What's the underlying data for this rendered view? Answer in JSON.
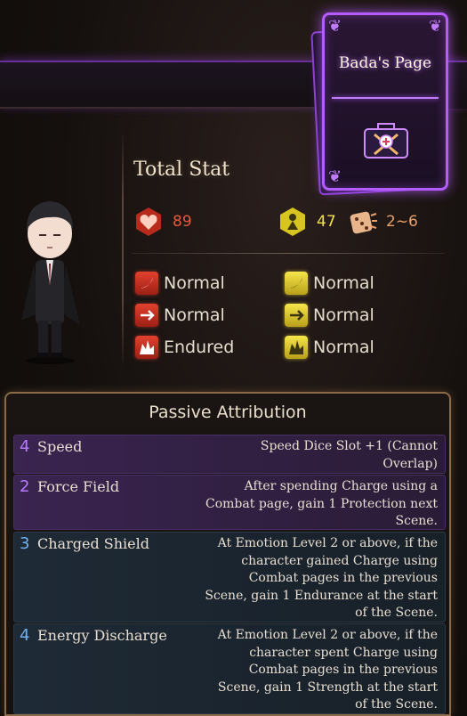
{
  "page_card": {
    "title": "Bada's Page",
    "emblem": "first-aid-kit-icon"
  },
  "total_stat": {
    "label": "Total Stat",
    "hp": "89",
    "stagger": "47",
    "speed": "2~6"
  },
  "resistances": {
    "hp": [
      {
        "type": "slash",
        "icon": "slash-resist-icon",
        "value": "Normal"
      },
      {
        "type": "pierce",
        "icon": "pierce-resist-icon",
        "value": "Normal"
      },
      {
        "type": "blunt",
        "icon": "blunt-resist-icon",
        "value": "Endured"
      }
    ],
    "stagger": [
      {
        "type": "slash",
        "icon": "slash-resist-icon",
        "value": "Normal"
      },
      {
        "type": "pierce",
        "icon": "pierce-resist-icon",
        "value": "Normal"
      },
      {
        "type": "blunt",
        "icon": "blunt-resist-icon",
        "value": "Normal"
      }
    ]
  },
  "passives": {
    "title": "Passive Attribution",
    "items": [
      {
        "cost": "4",
        "name": "Speed",
        "desc": "Speed Dice Slot +1 (Cannot Overlap)",
        "color": "purple"
      },
      {
        "cost": "2",
        "name": "Force Field",
        "desc": "After spending Charge using a Combat page, gain 1 Protection next Scene.",
        "color": "purple"
      },
      {
        "cost": "3",
        "name": "Charged Shield",
        "desc": "At Emotion Level 2 or above, if the character gained Charge using Combat pages in the previous Scene, gain 1 Endurance at the start of the Scene.",
        "color": "blue"
      },
      {
        "cost": "4",
        "name": "Energy Discharge",
        "desc": "At Emotion Level 2 or above, if the character spent Charge using Combat pages in the previous Scene, gain 1 Strength at the start of the Scene.",
        "color": "blue"
      }
    ]
  },
  "colors": {
    "accent_purple": "#b45cff",
    "hp_red": "#e45a3c",
    "stagger_yellow": "#f2e24a",
    "panel_gold": "#8a6a48"
  }
}
